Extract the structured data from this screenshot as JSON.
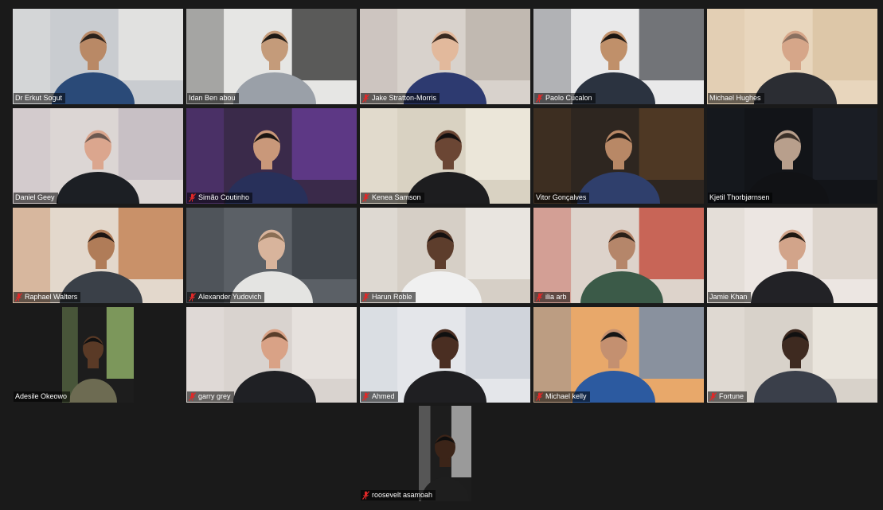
{
  "window": {
    "app": "Zoom Gallery View"
  },
  "colors": {
    "background": "#1a1a1a",
    "nameplate_bg": "rgba(0,0,0,0.55)",
    "mute_icon": "#e02828"
  },
  "participants": [
    {
      "name": "Dr Erkut Sogut",
      "muted": false,
      "bg": "#c9ccd0",
      "wall": "#e8e8e6",
      "shirt": "#2a4a78",
      "skin": "#b98966",
      "hair": "#2a211b",
      "icon": "person-icon"
    },
    {
      "name": "Idan Ben abou",
      "muted": false,
      "bg": "#e6e6e4",
      "wall": "#2b2b2b",
      "shirt": "#9aa0a8",
      "skin": "#c49b7a",
      "hair": "#1e1a16",
      "icon": "person-icon"
    },
    {
      "name": "Jake Stratton-Morris",
      "muted": true,
      "bg": "#d8d2cc",
      "wall": "#b9b0a8",
      "shirt": "#2d3a70",
      "skin": "#e2b99c",
      "hair": "#3a2a20",
      "icon": "person-icon"
    },
    {
      "name": "Paolo Cucalon",
      "muted": true,
      "bg": "#e9e9ea",
      "wall": "#4a4c52",
      "shirt": "#2b3340",
      "skin": "#c0906a",
      "hair": "#1b1613",
      "icon": "person-icon"
    },
    {
      "name": "Michael Hughes",
      "muted": false,
      "bg": "#e8d6bd",
      "wall": "#d9c2a2",
      "shirt": "#2b2d33",
      "skin": "#d6a689",
      "hair": "#8a7060",
      "icon": "person-icon"
    },
    {
      "name": "Daniel Geey",
      "muted": false,
      "bg": "#dcd6d4",
      "wall": "#c2b8c0",
      "shirt": "#1c1f24",
      "skin": "#dba68e",
      "hair": "#6c5850",
      "icon": "person-icon"
    },
    {
      "name": "Simão Coutinho",
      "muted": true,
      "bg": "#3a2a4a",
      "wall": "#6a3d9a",
      "shirt": "#28305a",
      "skin": "#c9987a",
      "hair": "#1a1512",
      "icon": "person-icon"
    },
    {
      "name": "Kenea Samson",
      "muted": true,
      "bg": "#d9d2c2",
      "wall": "#f0ece0",
      "shirt": "#1d1d1f",
      "skin": "#6b4634",
      "hair": "#141010",
      "icon": "person-icon"
    },
    {
      "name": "Vitor Gonçalves",
      "muted": false,
      "bg": "#2e2620",
      "wall": "#5a3f26",
      "shirt": "#2f3f6c",
      "skin": "#b88866",
      "hair": "#231b15",
      "icon": "person-icon"
    },
    {
      "name": "Kjetil Thorbjørnsen",
      "muted": false,
      "bg": "#121418",
      "wall": "#1d2028",
      "shirt": "#111215",
      "skin": "#b89f8c",
      "hair": "#3b3028",
      "icon": "person-icon"
    },
    {
      "name": "Raphael Walters",
      "muted": true,
      "bg": "#e3d8cc",
      "wall": "#c07a48",
      "shirt": "#3a4048",
      "skin": "#b07c58",
      "hair": "#1c1512",
      "icon": "person-icon"
    },
    {
      "name": "Alexander Yudovich",
      "muted": true,
      "bg": "#5b6066",
      "wall": "#3a3f45",
      "shirt": "#e4e4e2",
      "skin": "#d8b49c",
      "hair": "#8a6e54",
      "icon": "person-icon"
    },
    {
      "name": "Harun Roble",
      "muted": true,
      "bg": "#d6cfc6",
      "wall": "#efece8",
      "shirt": "#f0f0f0",
      "skin": "#5d3d2c",
      "hair": "#141010",
      "icon": "person-icon"
    },
    {
      "name": "ilia arb",
      "muted": true,
      "bg": "#ddd3cb",
      "wall": "#c04030",
      "shirt": "#3b5a48",
      "skin": "#b5866a",
      "hair": "#2a2018",
      "icon": "person-icon"
    },
    {
      "name": "Jamie Khan",
      "muted": false,
      "bg": "#ece6e2",
      "wall": "#d8cfc6",
      "shirt": "#222226",
      "skin": "#d2a48a",
      "hair": "#1e1812",
      "icon": "person-icon"
    },
    {
      "name": "Adesile Okeowo",
      "muted": false,
      "bg": "#1d1d1d",
      "wall": "#9cc070",
      "shirt": "#6d6b52",
      "skin": "#5a3a26",
      "hair": "#111",
      "icon": "person-icon"
    },
    {
      "name": "garry grey",
      "muted": true,
      "bg": "#d9d3cf",
      "wall": "#eae6e2",
      "shirt": "#1f2024",
      "skin": "#d9a286",
      "hair": "#5a3e2a",
      "icon": "person-icon"
    },
    {
      "name": "Ahmed",
      "muted": true,
      "bg": "#e4e6ea",
      "wall": "#c9ced6",
      "shirt": "#1f1f22",
      "skin": "#4a2e22",
      "hair": "#101010",
      "icon": "person-icon"
    },
    {
      "name": "Michael kelly",
      "muted": true,
      "bg": "#e8a86a",
      "wall": "#6a8ab0",
      "shirt": "#2c5aa0",
      "skin": "#c49070",
      "hair": "#151515",
      "icon": "person-icon"
    },
    {
      "name": "Fortune",
      "muted": true,
      "bg": "#d8d2ca",
      "wall": "#efe9e2",
      "shirt": "#3a3f4a",
      "skin": "#3e2a20",
      "hair": "#111",
      "icon": "person-icon"
    },
    {
      "name": "roosevelt asamoah",
      "muted": true,
      "bg": "#1d1d1d",
      "wall": "#c4c4c4",
      "shirt": "#1e1e1e",
      "skin": "#3b2418",
      "hair": "#0e0e0e",
      "icon": "person-icon"
    }
  ]
}
